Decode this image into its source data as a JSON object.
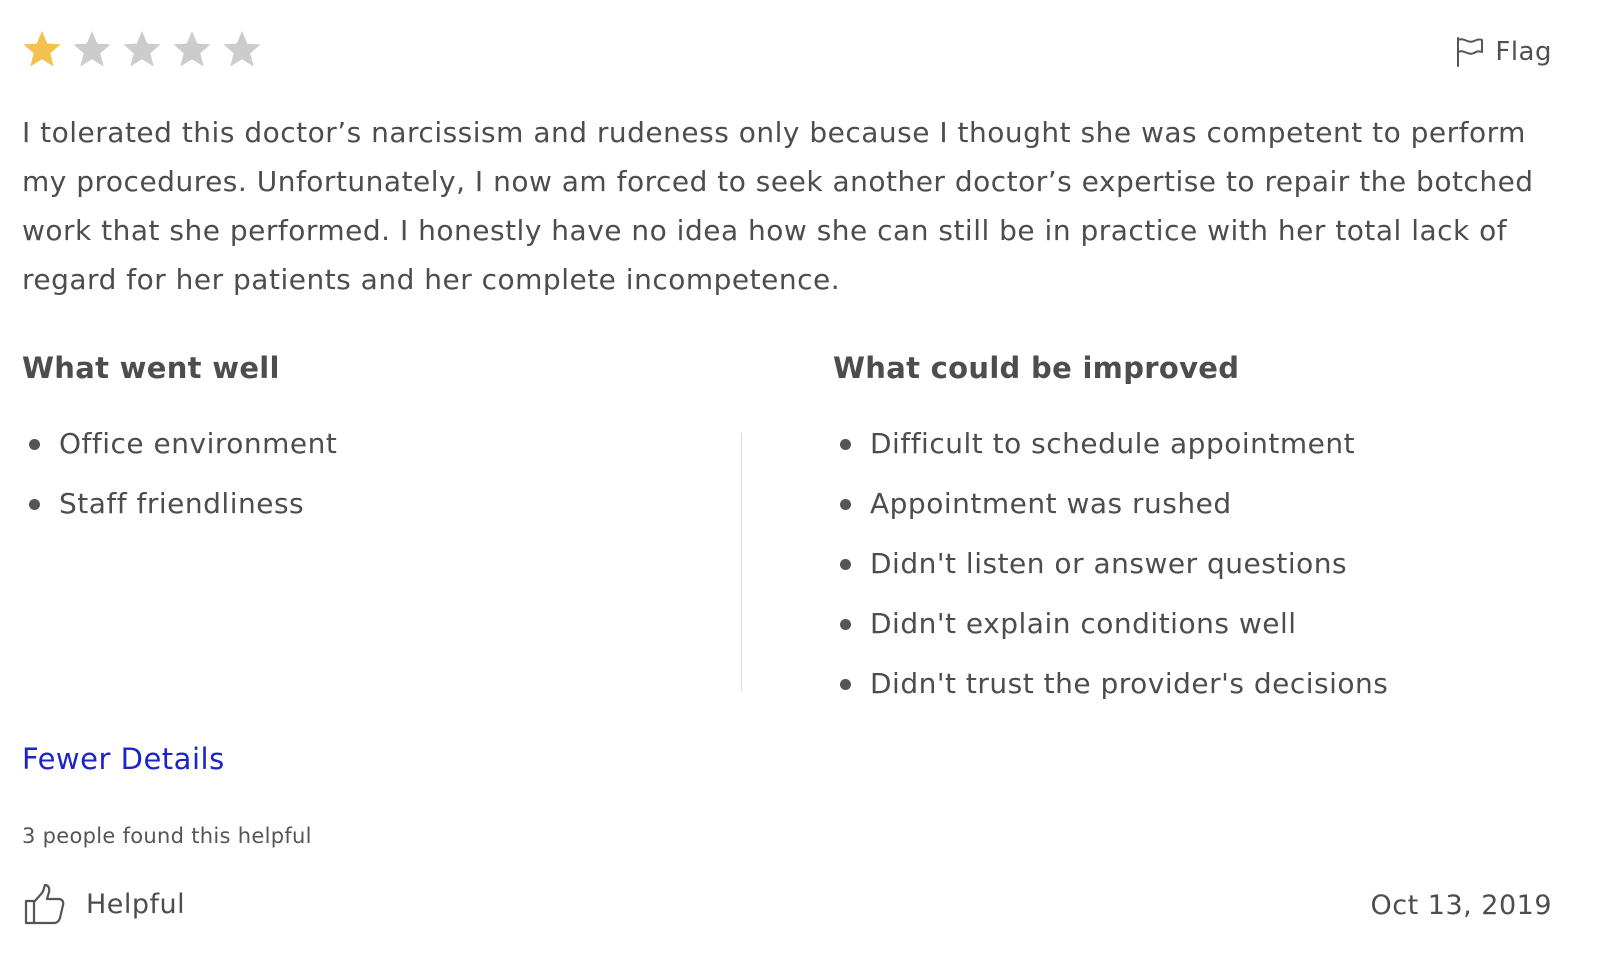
{
  "rating": {
    "value": 1,
    "max": 5,
    "filled_color": "#f2c14e",
    "empty_color": "#cccccc"
  },
  "flag": {
    "icon": "flag-icon",
    "label": "Flag"
  },
  "review": {
    "text": "I tolerated this doctor’s narcissism and rudeness only because I thought she was competent to perform my procedures. Unfortunately, I now am forced to seek another doctor’s expertise to repair the botched work that she performed. I honestly have no idea how she can still be in practice with her total lack of regard for her patients and her complete incompetence."
  },
  "went_well": {
    "heading": "What went well",
    "items": [
      "Office environment",
      "Staff friendliness"
    ]
  },
  "could_improve": {
    "heading": "What could be improved",
    "items": [
      "Difficult to schedule appointment",
      "Appointment was rushed",
      "Didn't listen or answer questions",
      "Didn't explain conditions well",
      "Didn't trust the provider's decisions"
    ]
  },
  "fewer_details": {
    "label": "Fewer Details",
    "color": "#1a24c9"
  },
  "helpful": {
    "count_text": "3 people found this helpful",
    "label": "Helpful",
    "icon": "thumbs-up-icon"
  },
  "date": "Oct 13, 2019"
}
